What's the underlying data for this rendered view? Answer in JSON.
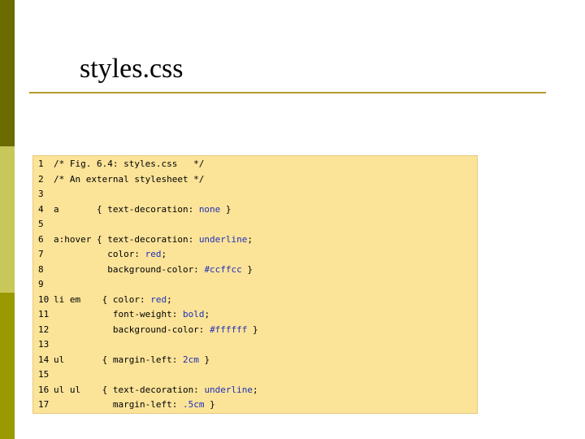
{
  "slide": {
    "title": "styles.css"
  },
  "code": {
    "lines": [
      {
        "n": "1",
        "segments": [
          {
            "t": "/* Fig. 6.4: styles.css   */",
            "c": "cm"
          }
        ]
      },
      {
        "n": "2",
        "segments": [
          {
            "t": "/* An external stylesheet */",
            "c": "cm"
          }
        ]
      },
      {
        "n": "3",
        "segments": []
      },
      {
        "n": "4",
        "segments": [
          {
            "t": "a       { text-decoration: ",
            "c": "k"
          },
          {
            "t": "none",
            "c": "v"
          },
          {
            "t": " }",
            "c": "k"
          }
        ]
      },
      {
        "n": "5",
        "segments": []
      },
      {
        "n": "6",
        "segments": [
          {
            "t": "a:hover { text-decoration: ",
            "c": "k"
          },
          {
            "t": "underline",
            "c": "v"
          },
          {
            "t": ";",
            "c": "k"
          }
        ]
      },
      {
        "n": "7",
        "segments": [
          {
            "t": "          color: ",
            "c": "k"
          },
          {
            "t": "red",
            "c": "v"
          },
          {
            "t": ";",
            "c": "k"
          }
        ]
      },
      {
        "n": "8",
        "segments": [
          {
            "t": "          background-color: ",
            "c": "k"
          },
          {
            "t": "#ccffcc",
            "c": "v"
          },
          {
            "t": " }",
            "c": "k"
          }
        ]
      },
      {
        "n": "9",
        "segments": []
      },
      {
        "n": "10",
        "segments": [
          {
            "t": "li em    { color: ",
            "c": "k"
          },
          {
            "t": "red",
            "c": "v"
          },
          {
            "t": ";",
            "c": "k"
          }
        ]
      },
      {
        "n": "11",
        "segments": [
          {
            "t": "           font-weight: ",
            "c": "k"
          },
          {
            "t": "bold",
            "c": "v"
          },
          {
            "t": ";",
            "c": "k"
          }
        ]
      },
      {
        "n": "12",
        "segments": [
          {
            "t": "           background-color: ",
            "c": "k"
          },
          {
            "t": "#ffffff",
            "c": "v"
          },
          {
            "t": " }",
            "c": "k"
          }
        ]
      },
      {
        "n": "13",
        "segments": []
      },
      {
        "n": "14",
        "segments": [
          {
            "t": "ul       { margin-left: ",
            "c": "k"
          },
          {
            "t": "2cm",
            "c": "v"
          },
          {
            "t": " }",
            "c": "k"
          }
        ]
      },
      {
        "n": "15",
        "segments": []
      },
      {
        "n": "16",
        "segments": [
          {
            "t": "ul ul    { text-decoration: ",
            "c": "k"
          },
          {
            "t": "underline",
            "c": "v"
          },
          {
            "t": ";",
            "c": "k"
          }
        ]
      },
      {
        "n": "17",
        "segments": [
          {
            "t": "           margin-left: ",
            "c": "k"
          },
          {
            "t": ".5cm",
            "c": "v"
          },
          {
            "t": " }",
            "c": "k"
          }
        ]
      }
    ]
  },
  "colors": {
    "code_background": "#fbe398",
    "value_color": "#1e2fb8",
    "rule_color": "#b59a2a"
  }
}
